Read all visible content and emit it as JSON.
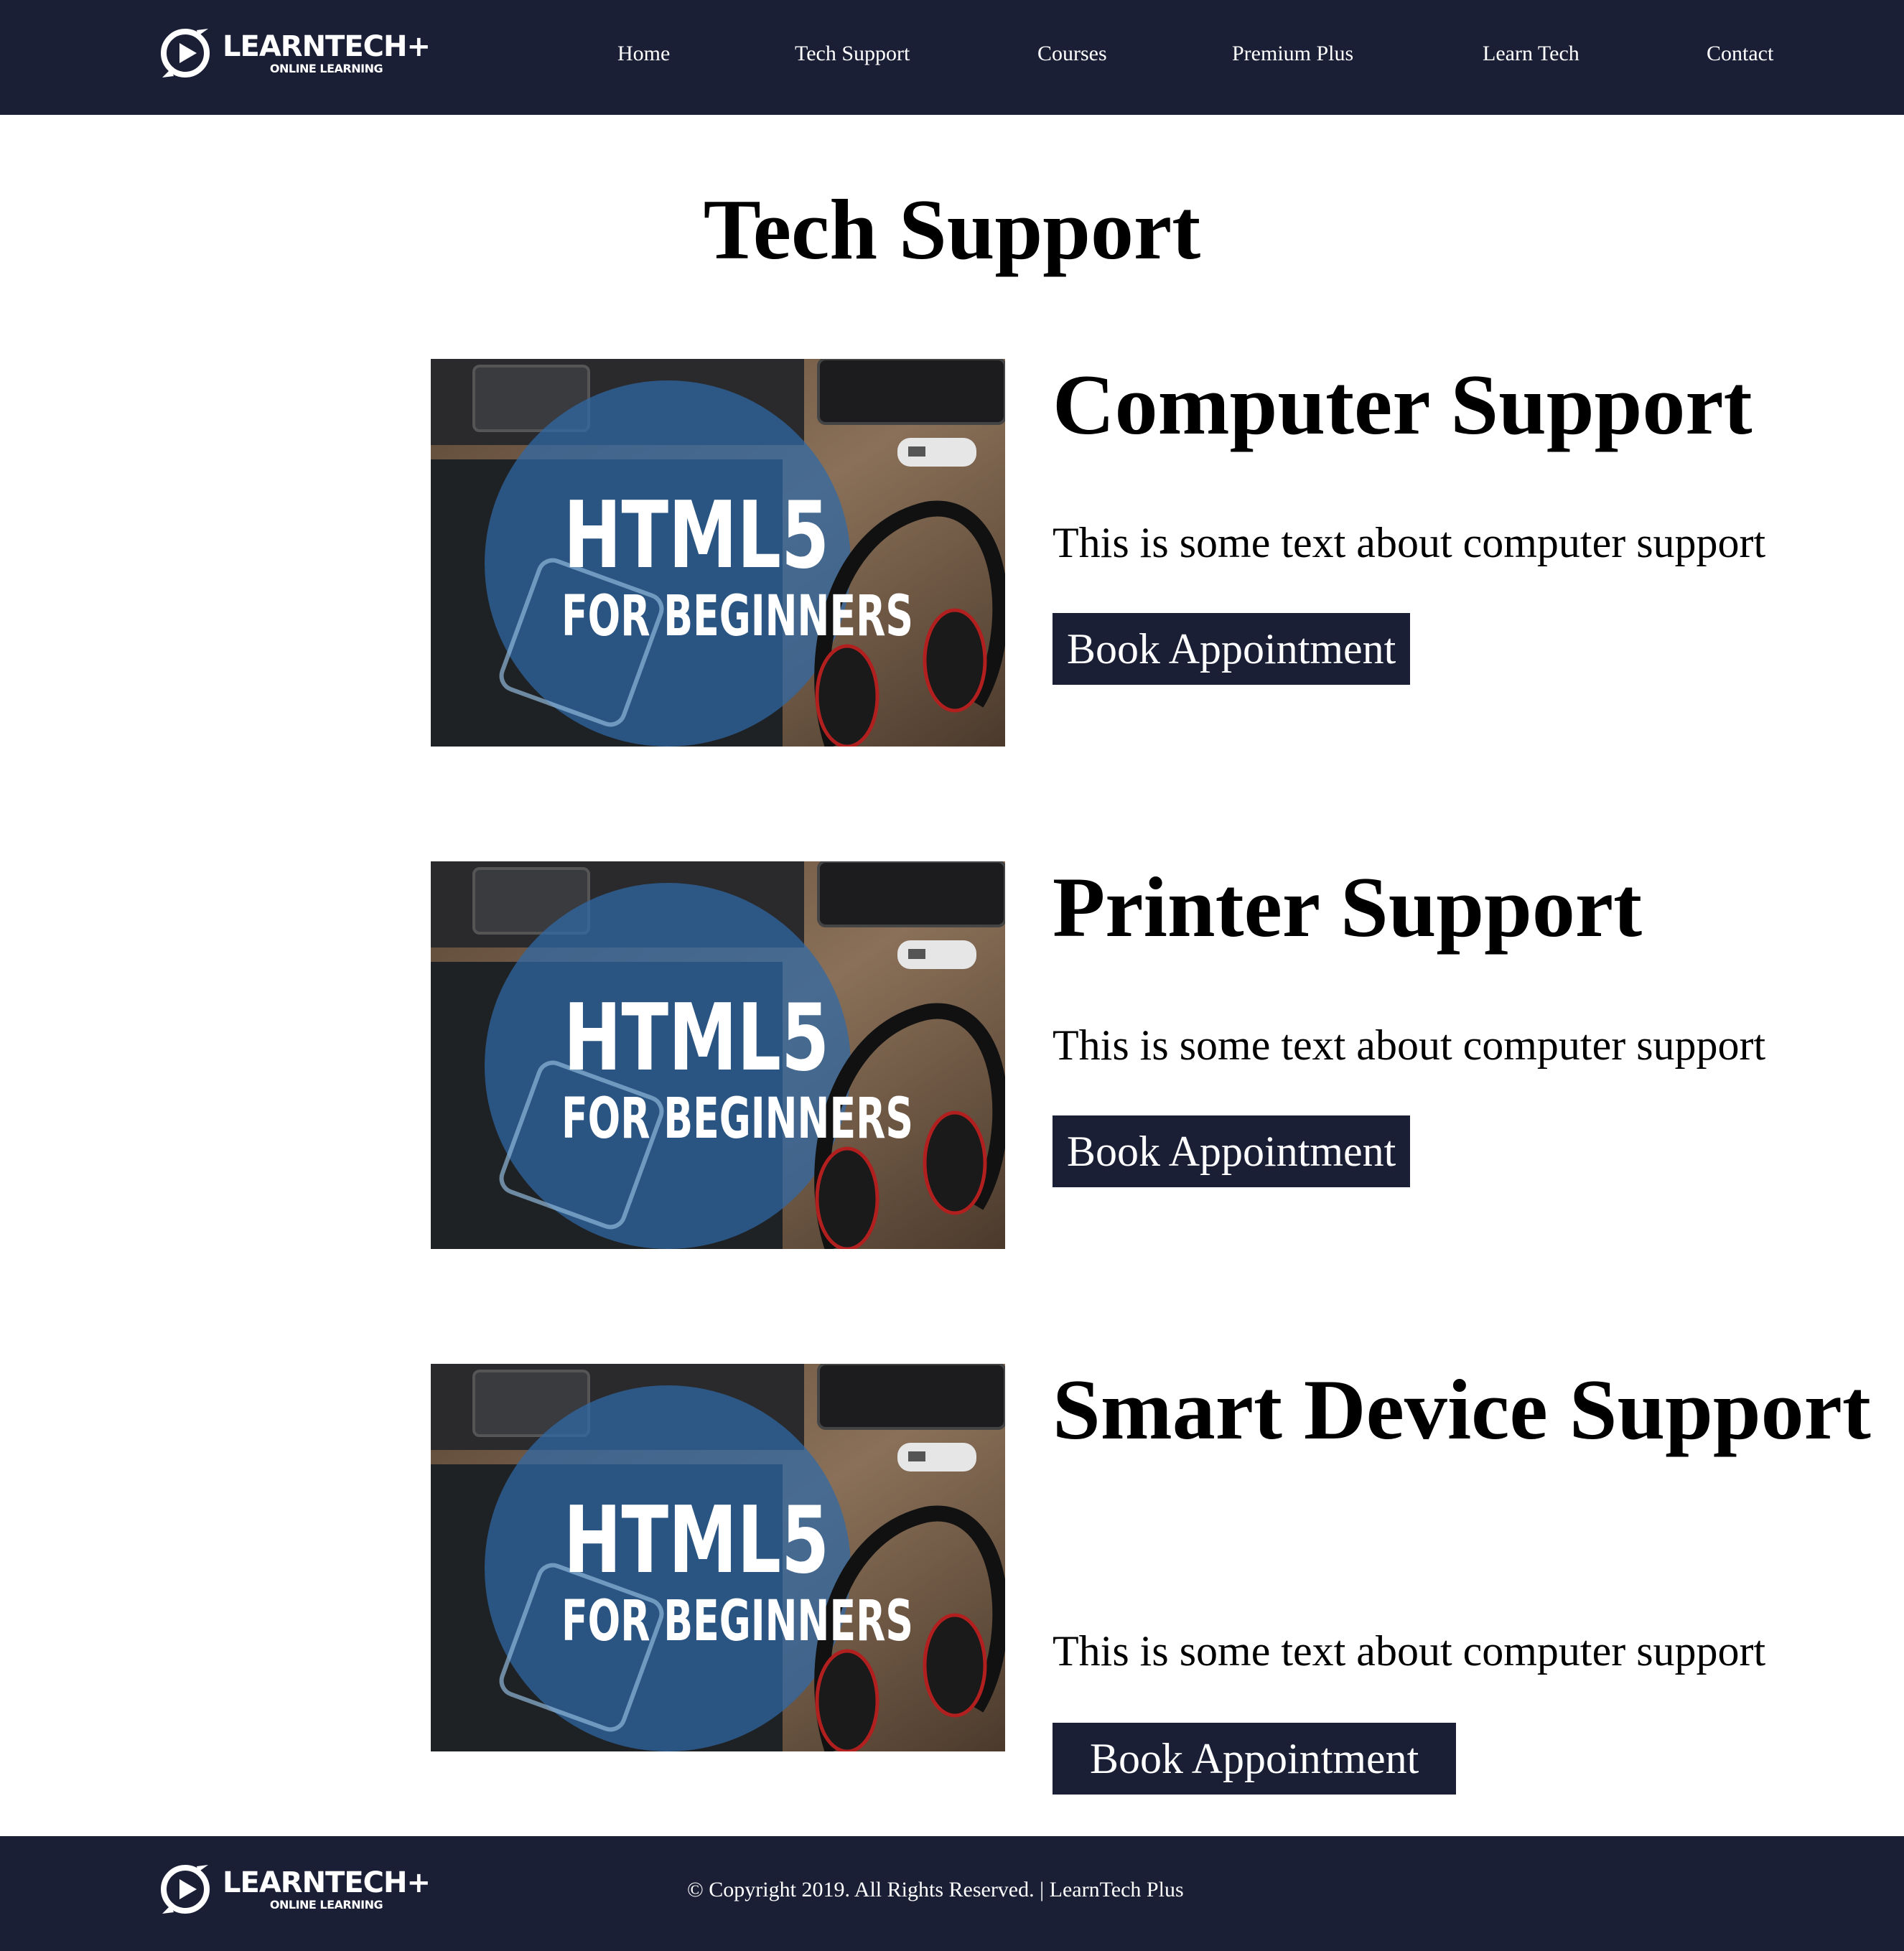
{
  "brand": {
    "name": "LEARNTECH+",
    "tagline": "ONLINE LEARNING",
    "logo_icon": "play-circle-icon"
  },
  "nav": {
    "items": [
      "Home",
      "Tech Support",
      "Courses",
      "Premium Plus",
      "Learn Tech",
      "Contact"
    ]
  },
  "page": {
    "title": "Tech Support"
  },
  "thumbnail": {
    "line1": "HTML5",
    "line2": "FOR BEGINNERS"
  },
  "cards": [
    {
      "title": "Computer Support",
      "text": "This is some text about computer support",
      "button": "Book Appointment"
    },
    {
      "title": "Printer Support",
      "text": "This is some text about computer support",
      "button": "Book Appointment"
    },
    {
      "title": "Smart Device Support",
      "text": "This is some text about computer support",
      "button": "Book Appointment"
    }
  ],
  "footer": {
    "copyright": "© Copyright 2019. All Rights Reserved. | LearnTech Plus"
  },
  "colors": {
    "navy": "#1a1f36",
    "white": "#ffffff"
  }
}
